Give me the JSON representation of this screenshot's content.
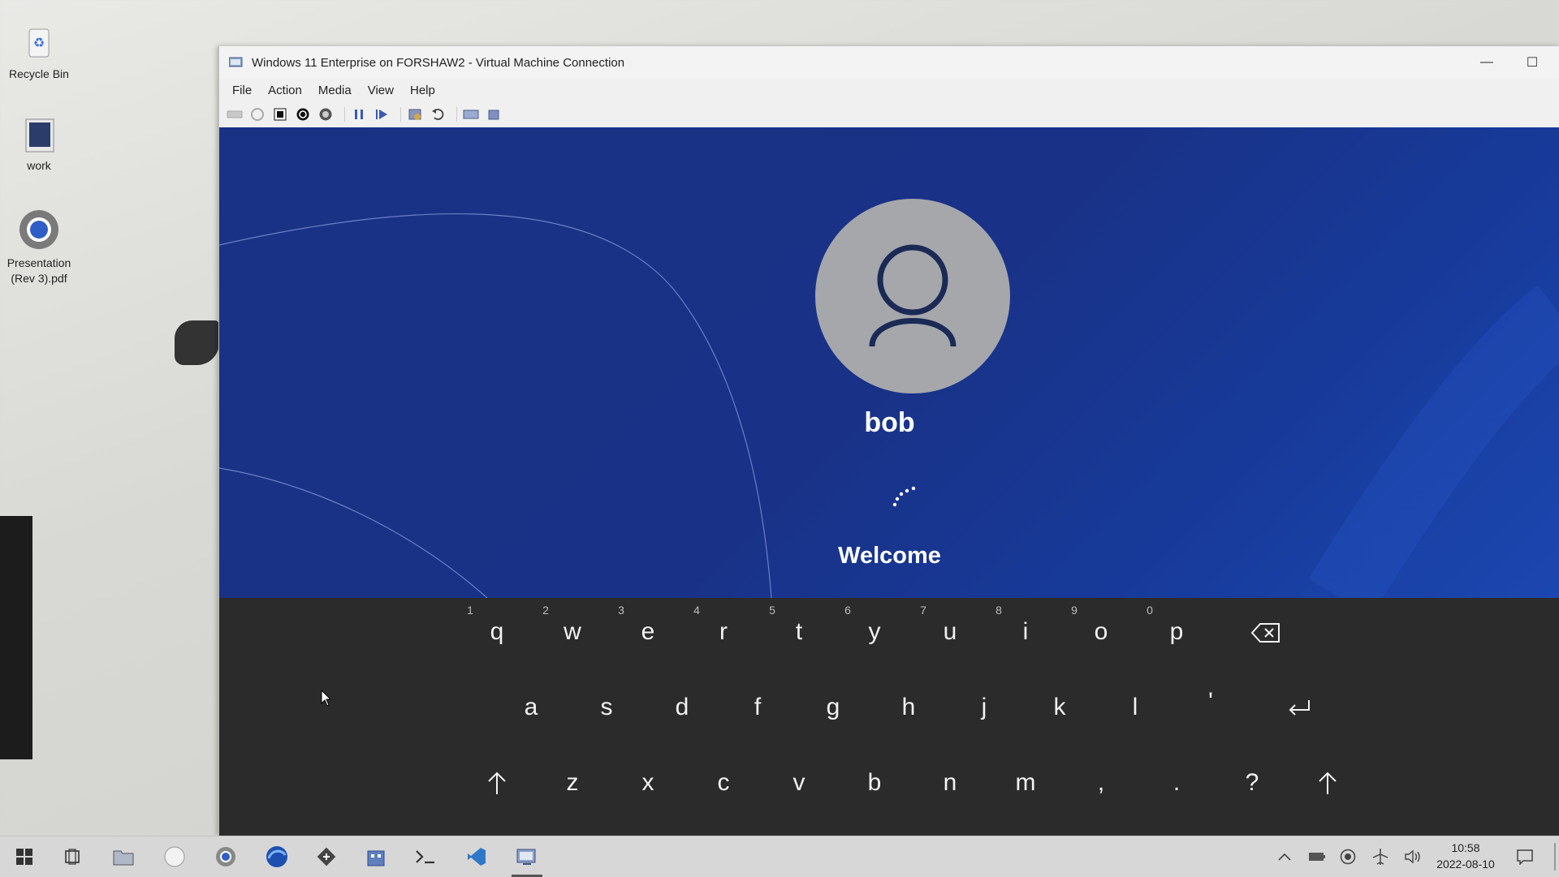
{
  "desktop": {
    "icons": [
      {
        "label": "Recycle Bin",
        "icon": "recycle-bin-icon"
      },
      {
        "label": "work",
        "icon": "folder-icon"
      },
      {
        "label": "Presentation (Rev 3).pdf",
        "icon": "chrome-icon"
      }
    ]
  },
  "window": {
    "title": "Windows 11 Enterprise on FORSHAW2 - Virtual Machine Connection",
    "menu": [
      "File",
      "Action",
      "Media",
      "View",
      "Help"
    ],
    "toolbar": [
      "ctrl-alt-del-icon",
      "start-icon",
      "turn-off-icon",
      "shutdown-icon",
      "save-icon",
      "pause-icon",
      "reset-icon",
      "checkpoint-icon",
      "revert-icon",
      "enhanced-session-icon",
      "share-icon"
    ],
    "minimize_glyph": "—",
    "maximize_glyph": "☐"
  },
  "login": {
    "user_name": "bob",
    "welcome": "Welcome"
  },
  "keyboard": {
    "row1": [
      {
        "key": "q",
        "num": "1"
      },
      {
        "key": "w",
        "num": "2"
      },
      {
        "key": "e",
        "num": "3"
      },
      {
        "key": "r",
        "num": "4"
      },
      {
        "key": "t",
        "num": "5"
      },
      {
        "key": "y",
        "num": "6"
      },
      {
        "key": "u",
        "num": "7"
      },
      {
        "key": "i",
        "num": "8"
      },
      {
        "key": "o",
        "num": "9"
      },
      {
        "key": "p",
        "num": "0"
      }
    ],
    "row2": [
      "a",
      "s",
      "d",
      "f",
      "g",
      "h",
      "j",
      "k",
      "l",
      "'"
    ],
    "row3": [
      "z",
      "x",
      "c",
      "v",
      "b",
      "n",
      "m",
      ",",
      ".",
      "?"
    ]
  },
  "taskbar": {
    "apps": [
      "windows-start-icon",
      "task-view-icon",
      "file-explorer-icon",
      "app-circle-icon",
      "chrome-icon",
      "edge-icon",
      "git-icon",
      "app-building-icon",
      "terminal-icon",
      "vscode-icon",
      "hyper-v-icon"
    ],
    "tray": [
      "chevron-up-icon",
      "battery-icon",
      "globe-icon",
      "airplane-icon",
      "volume-icon"
    ],
    "time": "10:58",
    "date": "2022-08-10"
  },
  "colors": {
    "login_bg": "#1a3285",
    "keyboard_bg": "#2b2b2b",
    "avatar_bg": "#a5a7ab"
  }
}
